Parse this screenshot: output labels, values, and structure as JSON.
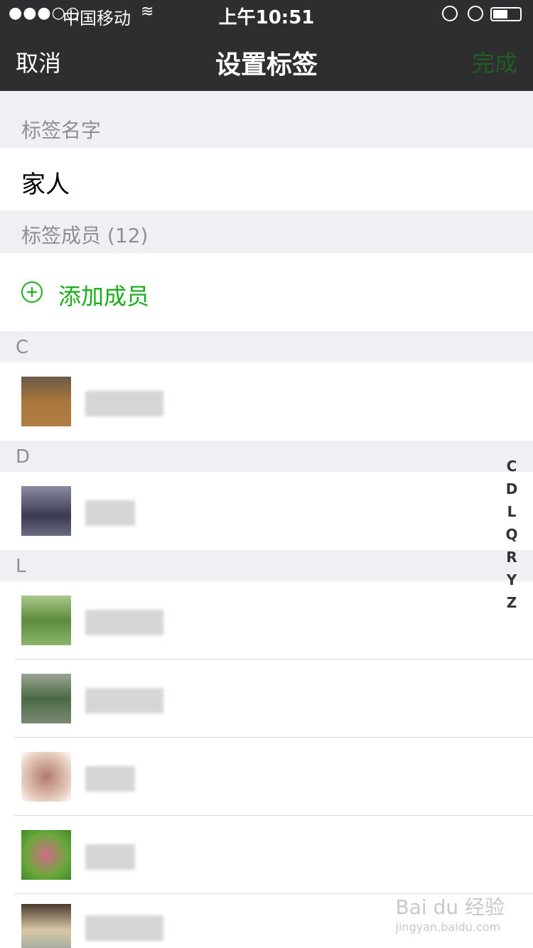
{
  "status_bar": {
    "signal": "●●●○○",
    "carrier": "中国移动",
    "wifi": "≋",
    "time": "上午10:51"
  },
  "nav": {
    "cancel": "取消",
    "title": "设置标签",
    "done": "完成"
  },
  "tag_name": {
    "header": "标签名字",
    "value": "家人"
  },
  "members": {
    "header": "标签成员 (12)",
    "add_label": "添加成员"
  },
  "sections": [
    "C",
    "D",
    "L"
  ],
  "index_letters": [
    "C",
    "D",
    "L",
    "Q",
    "R",
    "Y",
    "Z"
  ],
  "watermark": {
    "main": "Bai du 经验",
    "sub": "jingyan.baidu.com"
  },
  "colors": {
    "nav_bg": "#2e2e30",
    "accent": "#1aad19",
    "done_disabled": "#1f5f22"
  }
}
